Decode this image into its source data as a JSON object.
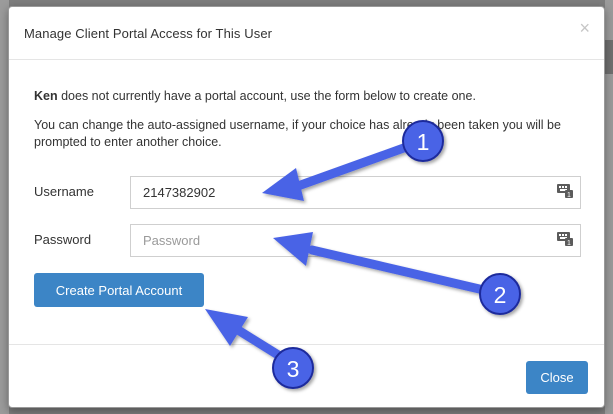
{
  "dialog": {
    "title": "Manage Client Portal Access for This User",
    "close_glyph": "×"
  },
  "body": {
    "user_name": "Ken",
    "intro_rest": " does not currently have a portal account, use the form below to create one.",
    "hint": "You can change the auto-assigned username, if your choice has already been taken you will be prompted to enter another choice."
  },
  "form": {
    "username_label": "Username",
    "username_value": "2147382902",
    "password_label": "Password",
    "password_placeholder": "Password",
    "create_button": "Create Portal Account"
  },
  "footer": {
    "close_button": "Close"
  },
  "annotations": {
    "badges": [
      "1",
      "2",
      "3"
    ],
    "arrow_color": "#4a63e6",
    "badge_stroke": "#1f2c9c"
  },
  "icons": {
    "field_icon": "keyboard-icon"
  },
  "colors": {
    "primary_button": "#3c85c6"
  }
}
